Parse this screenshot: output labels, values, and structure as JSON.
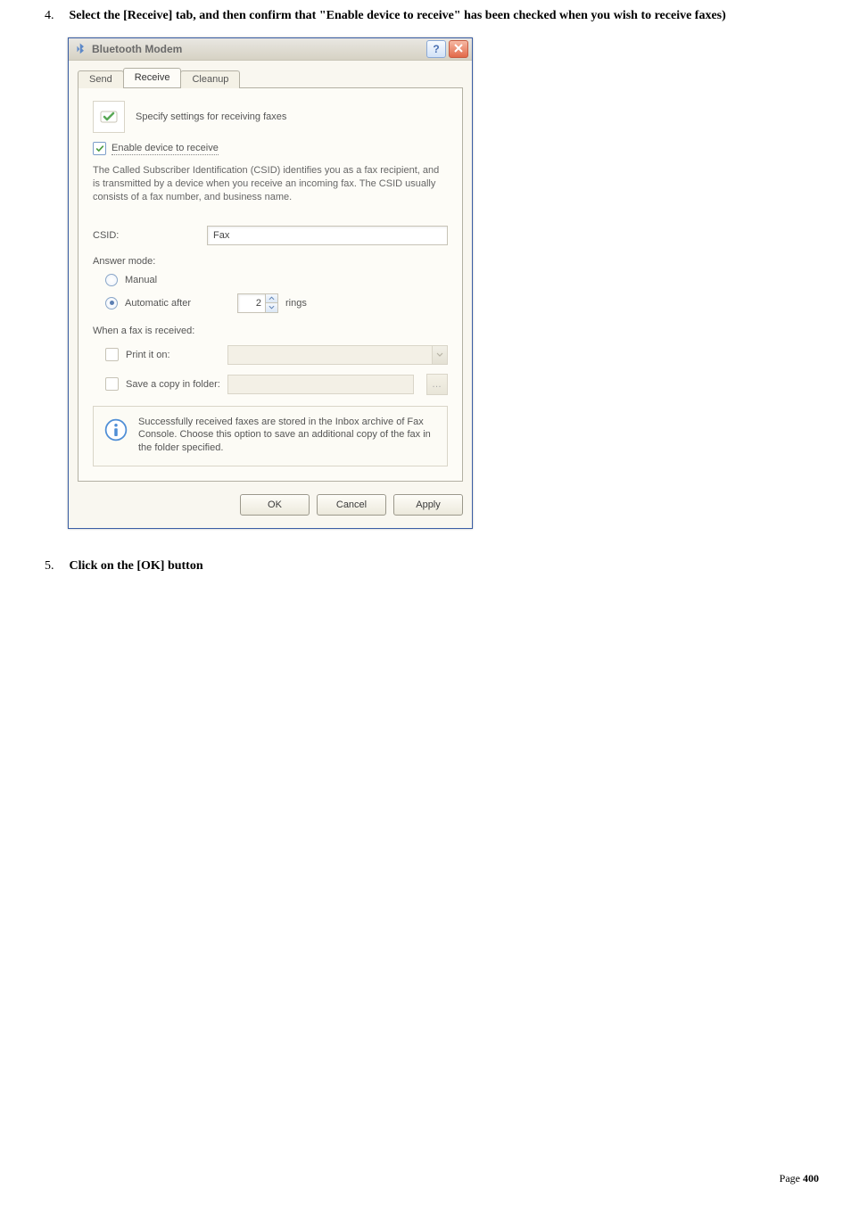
{
  "steps": {
    "s4": {
      "num": "4.",
      "text": "Select the [Receive] tab, and then confirm that \"Enable device to receive\" has been checked when you wish to receive faxes)"
    },
    "s5": {
      "num": "5.",
      "text": "Click on the [OK] button"
    }
  },
  "dialog": {
    "title": "Bluetooth Modem",
    "help_glyph": "?",
    "close_glyph": "X",
    "tabs": {
      "send": "Send",
      "receive": "Receive",
      "cleanup": "Cleanup"
    },
    "panel": {
      "specify": "Specify settings for receiving faxes",
      "enable": "Enable device to receive",
      "desc": "The Called Subscriber Identification (CSID) identifies you as a fax recipient, and is transmitted by a device when you receive an incoming fax. The CSID usually consists of a fax number, and business name.",
      "csid_label": "CSID:",
      "csid_value": "Fax",
      "answer_mode": "Answer mode:",
      "manual": "Manual",
      "automatic": "Automatic after",
      "rings_value": "2",
      "rings_label": "rings",
      "when_received": "When a fax is received:",
      "print_it": "Print it on:",
      "save_copy": "Save a copy in folder:",
      "info": "Successfully received faxes are stored in the Inbox archive of Fax Console. Choose this option to save an additional copy of the fax in the folder specified."
    },
    "buttons": {
      "ok": "OK",
      "cancel": "Cancel",
      "apply": "Apply"
    }
  },
  "footer": {
    "label": "Page",
    "num": "400"
  }
}
